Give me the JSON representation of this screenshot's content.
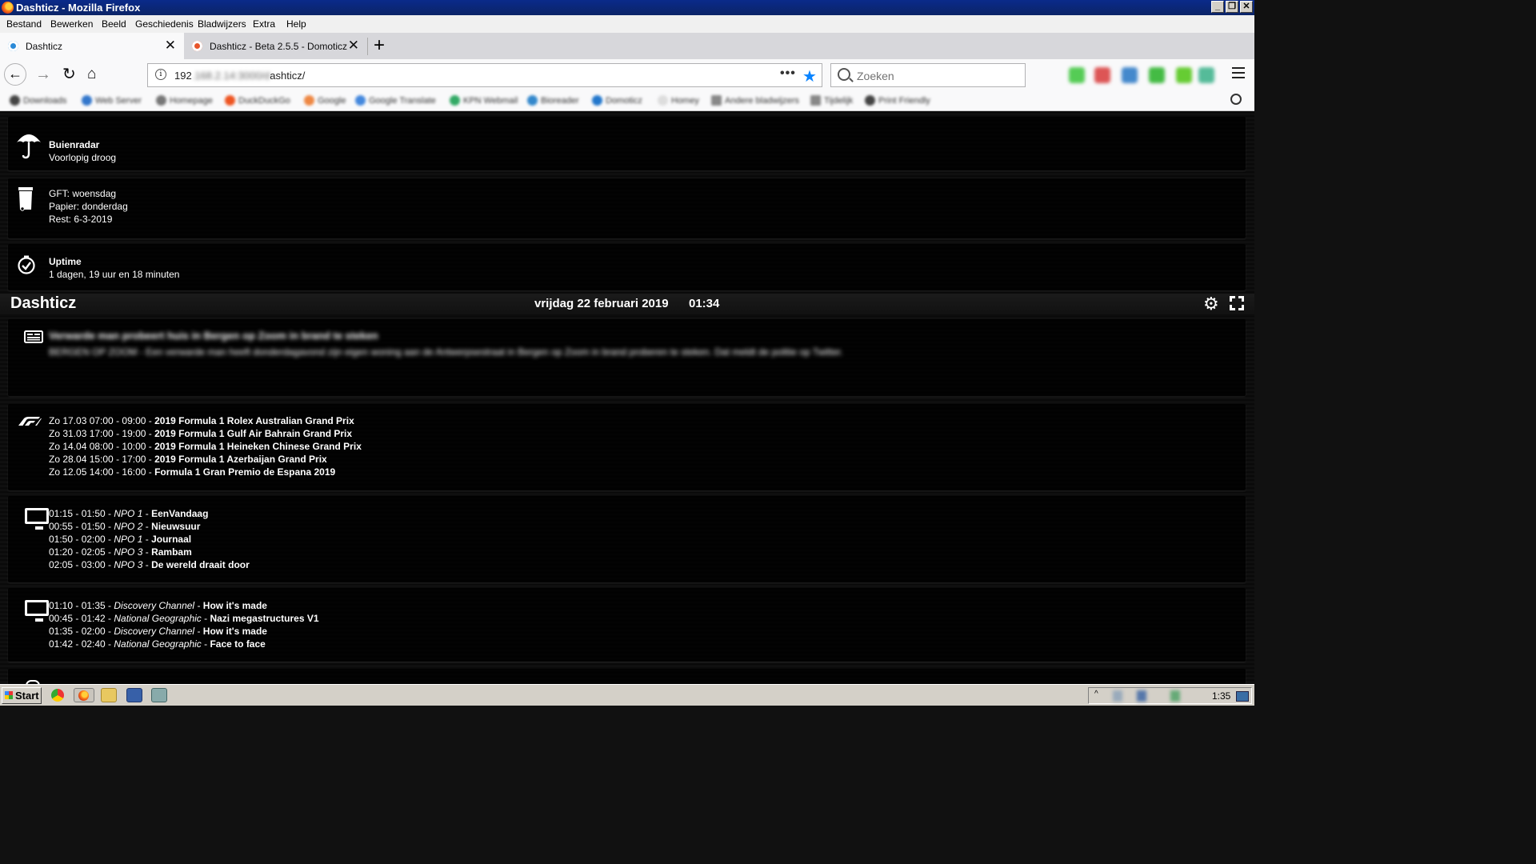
{
  "window": {
    "title": "Dashticz - Mozilla Firefox"
  },
  "menu": [
    "Bestand",
    "Bewerken",
    "Beeld",
    "Geschiedenis",
    "Bladwijzers",
    "Extra",
    "Help"
  ],
  "tabs": [
    {
      "label": "Dashticz",
      "active": true
    },
    {
      "label": "Dashticz - Beta 2.5.5 - Domoticz",
      "active": false
    }
  ],
  "nav": {
    "url_prefix": "192",
    "url_hidden": ".168.2.14:3000/d",
    "url_suffix": "ashticz/",
    "search_placeholder": "Zoeken"
  },
  "bookmarks": [
    "Downloads",
    "Web Server",
    "Homepage",
    "DuckDuckGo",
    "Google",
    "Google Translate",
    "KPN Webmail",
    "Bioreader",
    "Domoticz",
    "Homey",
    "Andere bladwijzers",
    "Tijdelijk",
    "Print Friendly"
  ],
  "panels": {
    "rain": {
      "title": "Buienradar",
      "subtitle": "Voorlopig droog"
    },
    "garbage": {
      "lines": [
        "GFT: woensdag",
        "Papier: donderdag",
        "Rest: 6-3-2019"
      ]
    },
    "uptime": {
      "title": "Uptime",
      "value": "1 dagen, 19 uur en 18 minuten"
    }
  },
  "header": {
    "title": "Dashticz",
    "date": "vrijdag 22 februari 2019",
    "time": "01:34"
  },
  "news": {
    "title": "Verwarde man probeert huis in Bergen op Zoom in brand te steken",
    "body": "BERGEN OP ZOOM - Een verwarde man heeft donderdagavond zijn eigen woning aan de Antwerpsestraat in Bergen op Zoom in brand proberen te steken. Dat meldt de politie op Twitter."
  },
  "f1": {
    "races": [
      {
        "when": "Zo 17.03 07:00 - 09:00 - ",
        "name": "2019 Formula 1 Rolex Australian Grand Prix"
      },
      {
        "when": "Zo 31.03 17:00 - 19:00 - ",
        "name": "2019 Formula 1 Gulf Air Bahrain Grand Prix"
      },
      {
        "when": "Zo 14.04 08:00 - 10:00 - ",
        "name": "2019 Formula 1 Heineken Chinese Grand Prix"
      },
      {
        "when": "Zo 28.04 15:00 - 17:00 - ",
        "name": "2019 Formula 1 Azerbaijan Grand Prix"
      },
      {
        "when": "Zo 12.05 14:00 - 16:00 - ",
        "name": "Formula 1 Gran Premio de Espana 2019"
      }
    ]
  },
  "tv1": {
    "items": [
      {
        "time": "01:15 - 01:50 - ",
        "channel": "NPO 1",
        "sep": " - ",
        "show": "EenVandaag"
      },
      {
        "time": "00:55 - 01:50 - ",
        "channel": "NPO 2",
        "sep": " - ",
        "show": "Nieuwsuur"
      },
      {
        "time": "01:50 - 02:00 - ",
        "channel": "NPO 1",
        "sep": " - ",
        "show": "Journaal"
      },
      {
        "time": "01:20 - 02:05 - ",
        "channel": "NPO 3",
        "sep": " - ",
        "show": "Rambam"
      },
      {
        "time": "02:05 - 03:00 - ",
        "channel": "NPO 3",
        "sep": " - ",
        "show": "De wereld draait door"
      }
    ]
  },
  "tv2": {
    "items": [
      {
        "time": "01:10 - 01:35 - ",
        "channel": "Discovery Channel",
        "sep": " - ",
        "show": "How it's made"
      },
      {
        "time": "00:45 - 01:42 - ",
        "channel": "National Geographic",
        "sep": " - ",
        "show": "Nazi megastructures V1"
      },
      {
        "time": "01:35 - 02:00 - ",
        "channel": "Discovery Channel",
        "sep": " - ",
        "show": "How it's made"
      },
      {
        "time": "01:42 - 02:40 - ",
        "channel": "National Geographic",
        "sep": " - ",
        "show": "Face to face"
      }
    ]
  },
  "taskbar": {
    "start": "Start",
    "clock": "1:35"
  },
  "colors": {
    "accent": "#0a84ff",
    "titlebar": "#0a2a8a",
    "dashboard_bg": "#111111"
  }
}
